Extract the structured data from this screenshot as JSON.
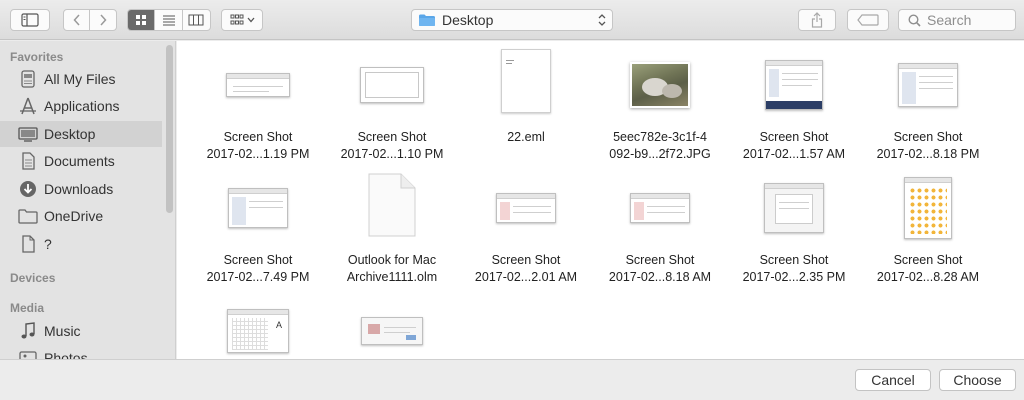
{
  "toolbar": {
    "location": "Desktop",
    "search_placeholder": "Search"
  },
  "sidebar": {
    "favorites_header": "Favorites",
    "favorites": [
      {
        "label": "All My Files",
        "icon": "all-files-icon"
      },
      {
        "label": "Applications",
        "icon": "applications-icon"
      },
      {
        "label": "Desktop",
        "icon": "desktop-icon",
        "selected": true
      },
      {
        "label": "Documents",
        "icon": "documents-icon"
      },
      {
        "label": "Downloads",
        "icon": "downloads-icon"
      },
      {
        "label": "OneDrive",
        "icon": "folder-icon"
      },
      {
        "label": "?",
        "icon": "document-icon"
      }
    ],
    "devices_header": "Devices",
    "media_header": "Media",
    "media": [
      {
        "label": "Music",
        "icon": "music-icon"
      },
      {
        "label": "Photos",
        "icon": "photos-icon"
      }
    ]
  },
  "files": [
    {
      "line1": "Screen Shot",
      "line2": "2017-02...1.19 PM",
      "kind": "screenshot"
    },
    {
      "line1": "Screen Shot",
      "line2": "2017-02...1.10 PM",
      "kind": "screenshot"
    },
    {
      "line1": "22.eml",
      "line2": "",
      "kind": "document"
    },
    {
      "line1": "5eec782e-3c1f-4",
      "line2": "092-b9...2f72.JPG",
      "kind": "photo"
    },
    {
      "line1": "Screen Shot",
      "line2": "2017-02...1.57 AM",
      "kind": "screenshot"
    },
    {
      "line1": "Screen Shot",
      "line2": "2017-02...8.18 PM",
      "kind": "screenshot"
    },
    {
      "line1": "Screen Shot",
      "line2": "2017-02...7.49 PM",
      "kind": "screenshot"
    },
    {
      "line1": "Outlook for Mac",
      "line2": "Archive1111.olm",
      "kind": "generic-file"
    },
    {
      "line1": "Screen Shot",
      "line2": "2017-02...2.01 AM",
      "kind": "screenshot"
    },
    {
      "line1": "Screen Shot",
      "line2": "2017-02...8.18 AM",
      "kind": "screenshot"
    },
    {
      "line1": "Screen Shot",
      "line2": "2017-02...2.35 PM",
      "kind": "screenshot"
    },
    {
      "line1": "Screen Shot",
      "line2": "2017-02...8.28 AM",
      "kind": "screenshot"
    },
    {
      "line1": "",
      "line2": "",
      "kind": "screenshot"
    },
    {
      "line1": "",
      "line2": "",
      "kind": "screenshot"
    }
  ],
  "buttons": {
    "cancel": "Cancel",
    "choose": "Choose"
  },
  "colors": {
    "accent_folder": "#5aa6e8",
    "selection": "#d2d2d2"
  }
}
